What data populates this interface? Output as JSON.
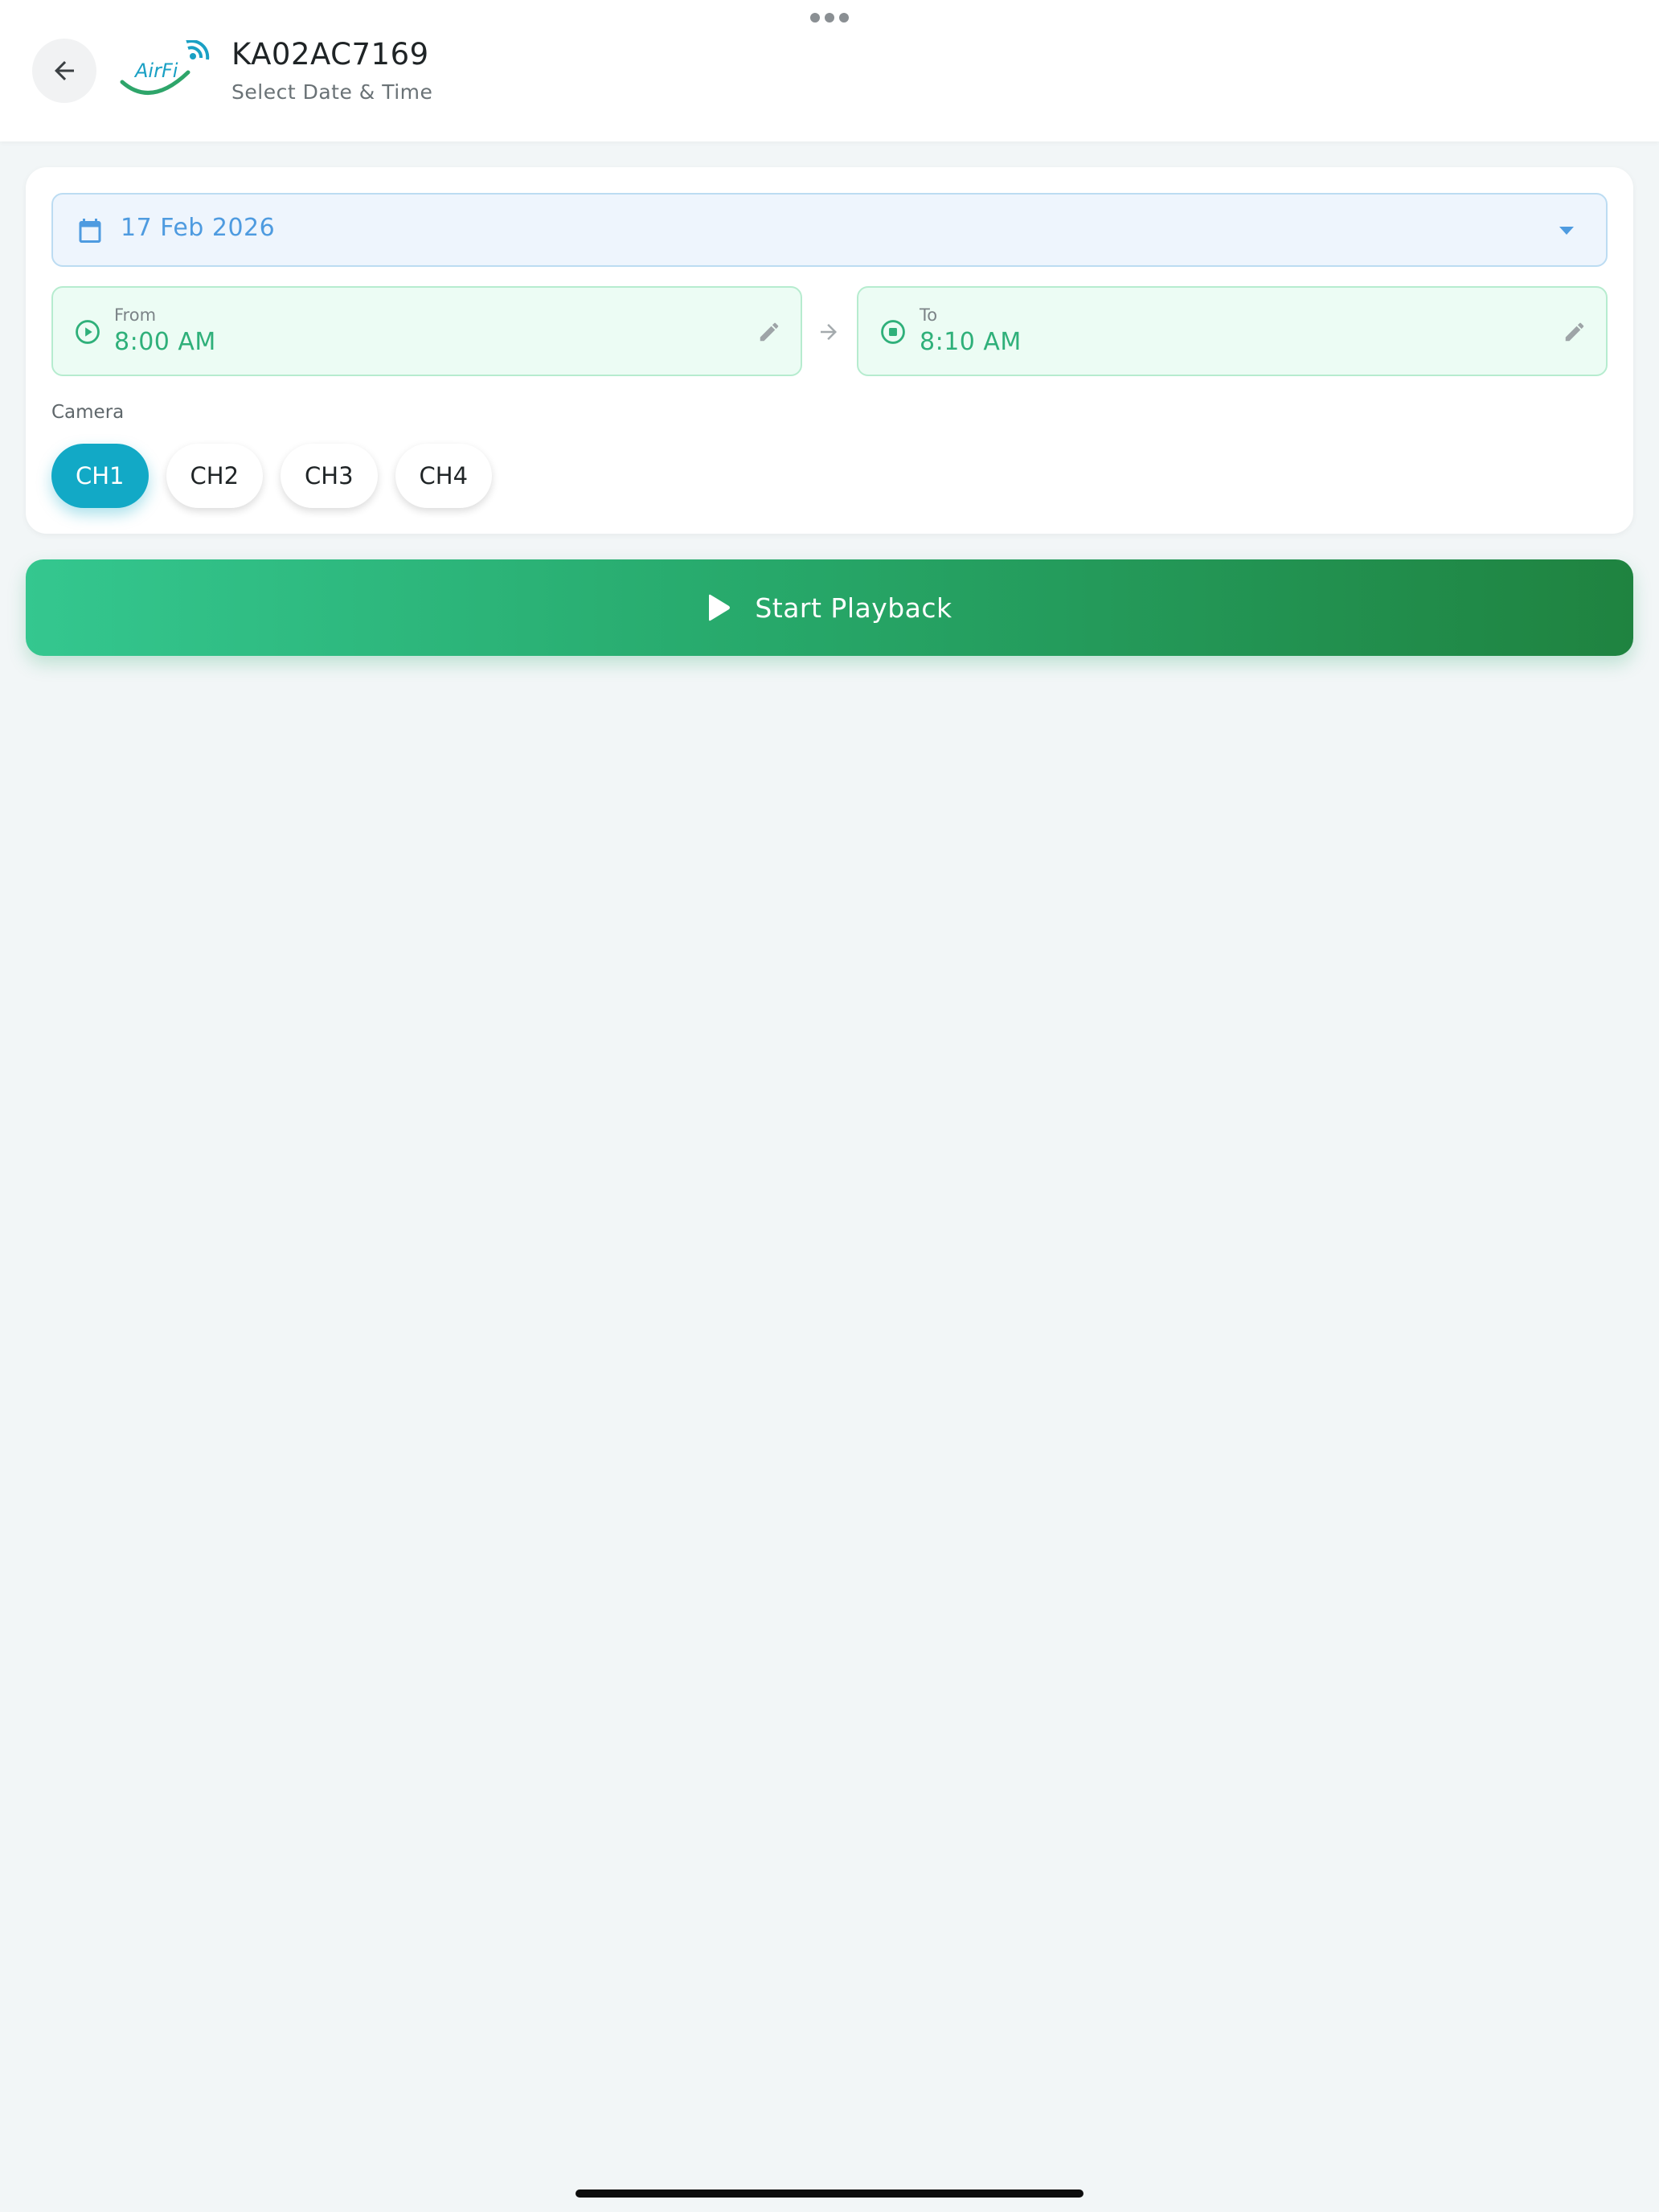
{
  "header": {
    "title": "KA02AC7169",
    "subtitle": "Select Date & Time",
    "logo_text": "AirFi"
  },
  "date_picker": {
    "value": "17 Feb 2026"
  },
  "time_range": {
    "from": {
      "label": "From",
      "value": "8:00 AM"
    },
    "to": {
      "label": "To",
      "value": "8:10 AM"
    }
  },
  "camera": {
    "label": "Camera",
    "channels": [
      "CH1",
      "CH2",
      "CH3",
      "CH4"
    ],
    "selected": "CH1"
  },
  "actions": {
    "start_playback": "Start Playback"
  },
  "icons": {
    "back": "arrow-left-icon",
    "calendar": "calendar-icon",
    "dropdown": "caret-down-icon",
    "from": "play-circle-icon",
    "to": "stop-circle-icon",
    "edit": "pencil-icon",
    "range_arrow": "arrow-right-icon",
    "play": "play-icon",
    "more": "more-dots-icon"
  },
  "colors": {
    "accent_teal": "#12a9c6",
    "accent_green": "#2fb07a",
    "date_blue": "#4e9be0",
    "button_gradient_start": "#34c78f",
    "button_gradient_end": "#1f8340",
    "background": "#f2f6f7"
  }
}
